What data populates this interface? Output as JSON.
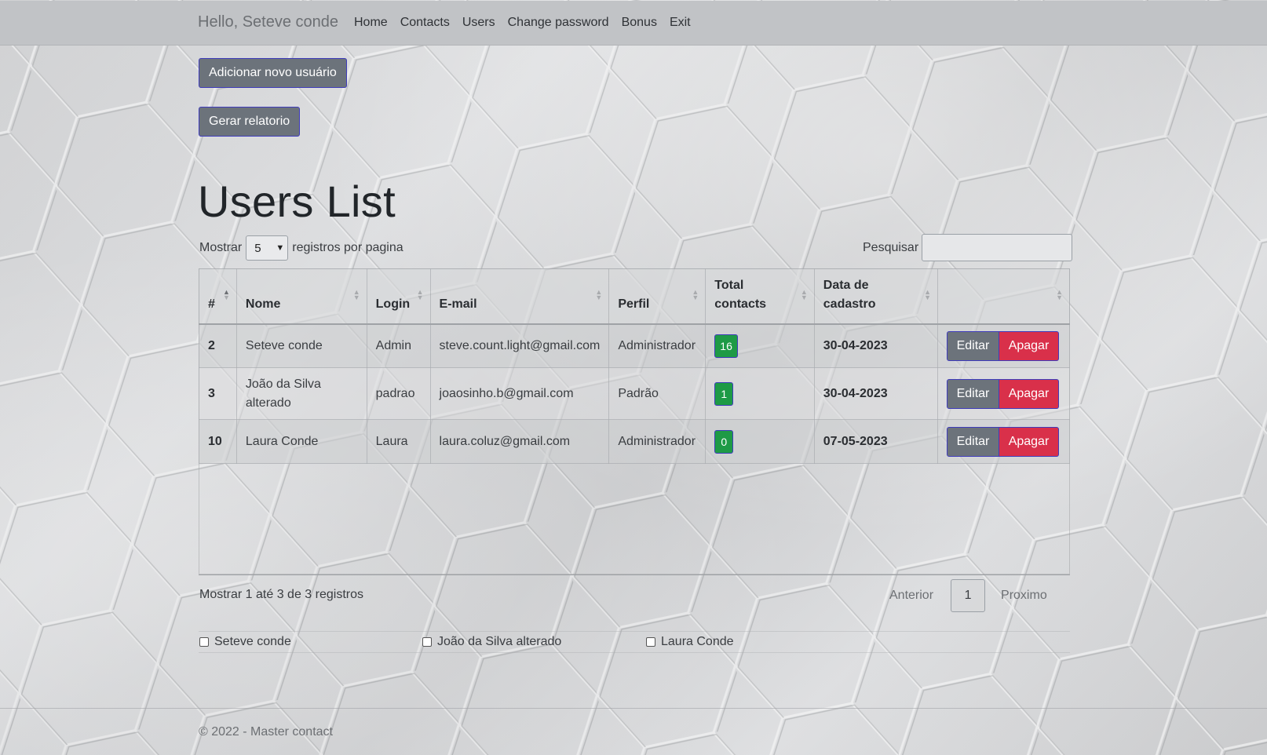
{
  "nav": {
    "greeting": "Hello, Seteve conde",
    "links": [
      "Home",
      "Contacts",
      "Users",
      "Change password",
      "Bonus",
      "Exit"
    ]
  },
  "actions": {
    "add_user": "Adicionar novo usuário",
    "report": "Gerar relatorio"
  },
  "page_title": "Users List",
  "table_controls": {
    "show_prefix": "Mostrar",
    "page_size": "5",
    "show_suffix": "registros por pagina",
    "search_label": "Pesquisar",
    "search_value": ""
  },
  "table": {
    "columns": [
      "#",
      "Nome",
      "Login",
      "E-mail",
      "Perfil",
      "Total contacts",
      "Data de cadastro",
      ""
    ],
    "rows": [
      {
        "id": "2",
        "nome": "Seteve conde",
        "login": "Admin",
        "email": "steve.count.light@gmail.com",
        "perfil": "Administrador",
        "total": "16",
        "data": "30-04-2023"
      },
      {
        "id": "3",
        "nome": "João da Silva alterado",
        "login": "padrao",
        "email": "joaosinho.b@gmail.com",
        "perfil": "Padrão",
        "total": "1",
        "data": "30-04-2023"
      },
      {
        "id": "10",
        "nome": "Laura Conde",
        "login": "Laura",
        "email": "laura.coluz@gmail.com",
        "perfil": "Administrador",
        "total": "0",
        "data": "07-05-2023"
      }
    ],
    "edit_label": "Editar",
    "delete_label": "Apagar"
  },
  "pagination": {
    "info": "Mostrar 1 até 3 de 3 registros",
    "previous": "Anterior",
    "current": "1",
    "next": "Proximo"
  },
  "checkboxes": [
    "Seteve conde",
    "João da Silva alterado",
    "Laura Conde"
  ],
  "footer": "© 2022 - Master contact",
  "colors": {
    "button_gray": "#6c737b",
    "button_red": "#d9304a",
    "badge_green": "#1e9a46",
    "button_border": "#3f3cbb"
  }
}
